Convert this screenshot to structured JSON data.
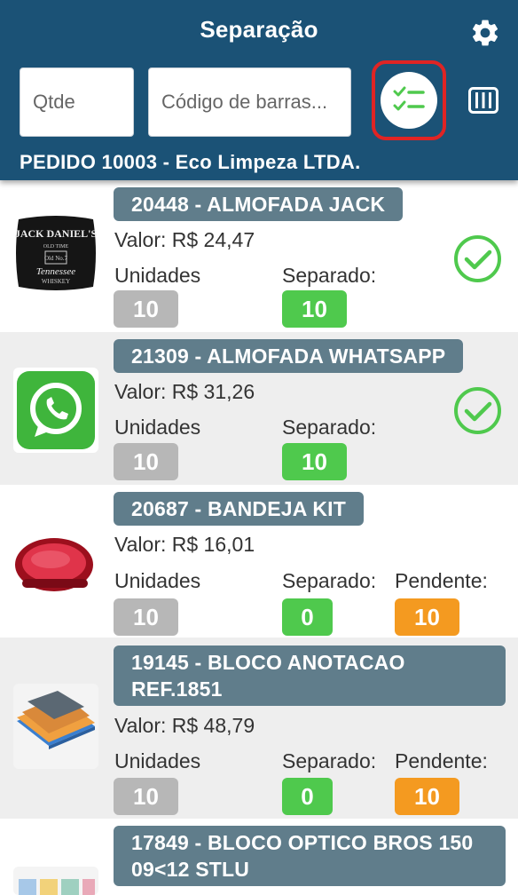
{
  "header": {
    "title": "Separação",
    "qty_placeholder": "Qtde",
    "barcode_placeholder": "Código de barras...",
    "order_title": "PEDIDO 10003 - Eco Limpeza LTDA."
  },
  "labels": {
    "units": "Unidades",
    "separated": "Separado:",
    "pending": "Pendente:"
  },
  "colors": {
    "header_bg": "#1b5276",
    "name_badge": "#607d8b",
    "units_pill": "#b7b7b7",
    "separated_pill": "#4fc94d",
    "pending_pill": "#f49a20",
    "check_green": "#4fc94d",
    "highlight_red": "#e02424"
  },
  "items": [
    {
      "name": "20448 - ALMOFADA JACK",
      "value": "Valor: R$ 24,47",
      "units": "10",
      "separated": "10",
      "pending": "",
      "complete": true,
      "image": "jack-daniels-pillow"
    },
    {
      "name": "21309 - ALMOFADA WHATSAPP",
      "value": "Valor: R$ 31,26",
      "units": "10",
      "separated": "10",
      "pending": "",
      "complete": true,
      "image": "whatsapp-pillow"
    },
    {
      "name": "20687 - BANDEJA KIT",
      "value": "Valor: R$ 16,01",
      "units": "10",
      "separated": "0",
      "pending": "10",
      "complete": false,
      "image": "red-tray"
    },
    {
      "name": "19145 - BLOCO ANOTACAO REF.1851",
      "value": "Valor: R$ 48,79",
      "units": "10",
      "separated": "0",
      "pending": "10",
      "complete": false,
      "image": "notebook-block"
    },
    {
      "name": "17849 - BLOCO OPTICO BROS 150 09<12 STLU",
      "value": "",
      "units": "",
      "separated": "",
      "pending": "",
      "complete": false,
      "image": "optical-block"
    }
  ]
}
